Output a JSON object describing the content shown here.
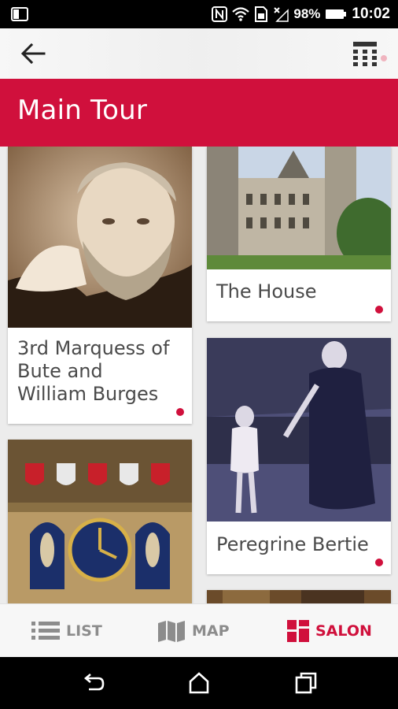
{
  "status_bar": {
    "battery": "98%",
    "time": "10:02"
  },
  "toolbar": {
    "back_icon": "arrow-left-icon",
    "menu_icon": "calculator-grid-icon"
  },
  "header": {
    "title": "Main Tour"
  },
  "cards": [
    {
      "label": "3rd Marquess of Bute and William Burges",
      "image": "portrait-photo"
    },
    {
      "label": "The House",
      "image": "castle-photo"
    },
    {
      "label": "",
      "image": "clock-tower-photo"
    },
    {
      "label": "Peregrine Bertie",
      "image": "woman-child-photo"
    },
    {
      "label": "",
      "image": "partial-photo"
    }
  ],
  "bottom_nav": {
    "items": [
      {
        "label": "LIST",
        "icon": "list-icon",
        "active": false
      },
      {
        "label": "MAP",
        "icon": "map-icon",
        "active": false
      },
      {
        "label": "SALON",
        "icon": "salon-grid-icon",
        "active": true
      }
    ]
  },
  "colors": {
    "accent": "#d0103c",
    "inactive": "#8c8c8c"
  }
}
